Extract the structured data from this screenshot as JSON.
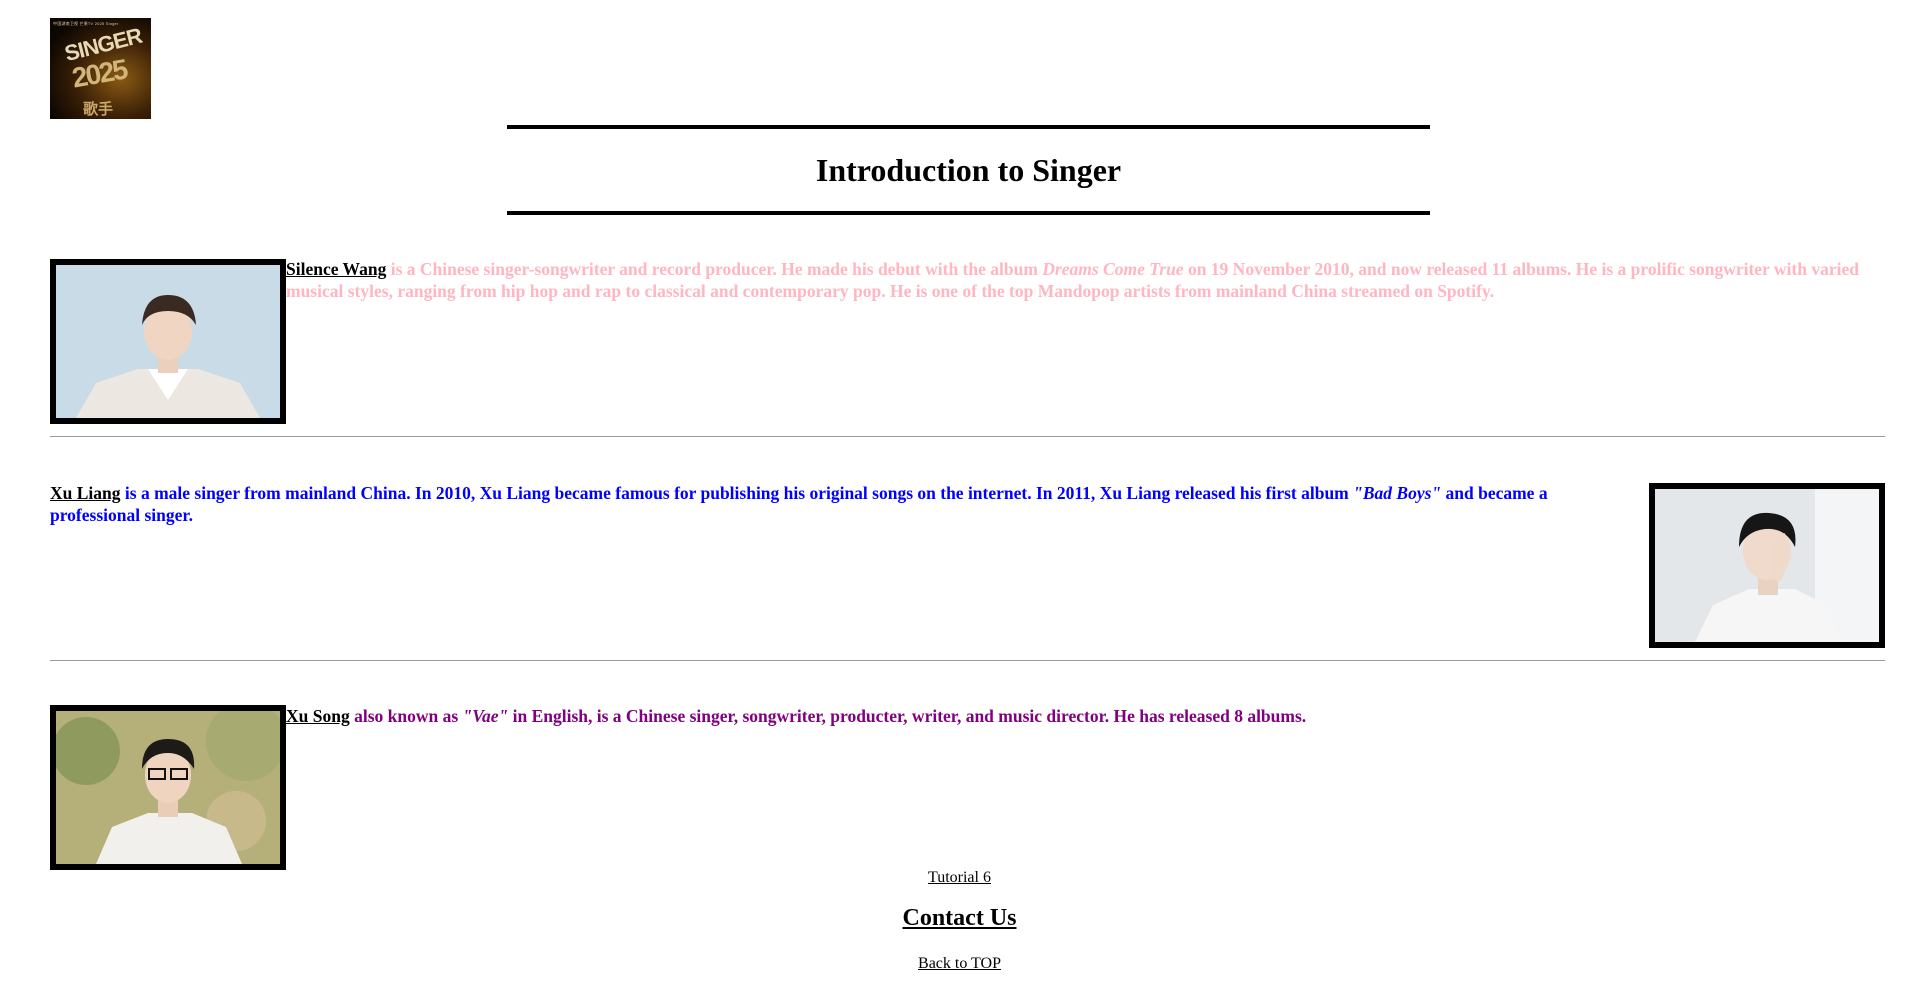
{
  "logo": {
    "top_line": "中国湖南卫视 芒果TV 2025 Singer",
    "word": "SINGER",
    "year": "2025",
    "chinese": "歌手"
  },
  "page_title": "Introduction to Singer",
  "singers": [
    {
      "name": "Silence Wang",
      "color": "#ffb6c1",
      "text_before_album": " is a Chinese singer-songwriter and record producer. He made his debut with the album ",
      "album": "Dreams Come True",
      "text_after_album": " on 19 November 2010, and now released 11 albums. He is a prolific songwriter with varied musical styles, ranging from hip hop and rap to classical and contemporary pop. He is one of the top Mandopop artists from mainland China streamed on Spotify."
    },
    {
      "name": "Xu Liang",
      "color": "#0000ff",
      "text_before_album": " is a male singer from mainland China. In 2010, Xu Liang became famous for publishing his original songs on the internet. In 2011, Xu Liang released his first album ",
      "album": "\"Bad Boys\"",
      "text_after_album": " and became a professional singer."
    },
    {
      "name": "Xu Song",
      "color": "#800080",
      "text_before_album": " also known as ",
      "album": "\"Vae\"",
      "text_after_album": " in English, is a Chinese singer, songwriter, producter, writer, and music director. He has released 8 albums."
    }
  ],
  "footer": {
    "tutorial_link": "Tutorial 6",
    "contact_heading": "Contact Us",
    "back_to_top": "Back to TOP"
  }
}
